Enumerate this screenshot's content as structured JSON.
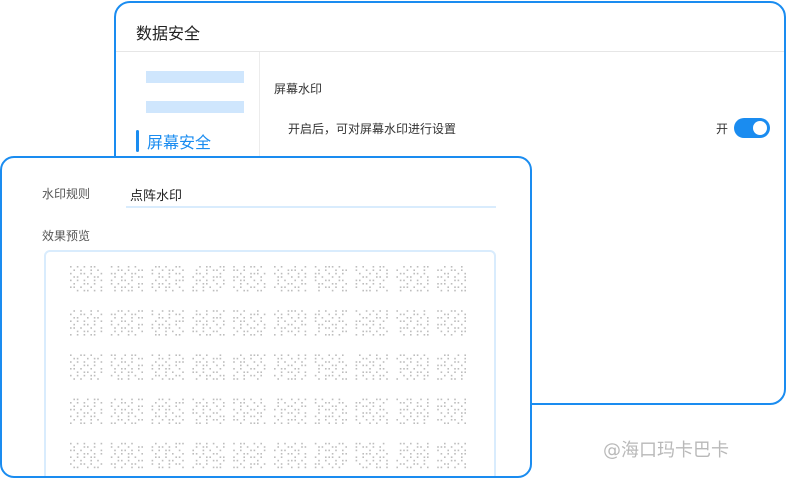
{
  "back_window": {
    "title": "数据安全",
    "nav": {
      "active_label": "屏幕安全"
    },
    "section_title": "屏幕水印",
    "setting": {
      "description": "开启后，可对屏幕水印进行设置",
      "toggle_label": "开",
      "toggle_on": true
    }
  },
  "front_window": {
    "rule_label": "水印规则",
    "rule_value": "点阵水印",
    "preview_label": "效果预览"
  },
  "page_watermark": "@海口玛卡巴卡",
  "colors": {
    "accent": "#1a8cf0",
    "light_accent": "#cfe6fd",
    "dot": "#bdbdbd"
  }
}
